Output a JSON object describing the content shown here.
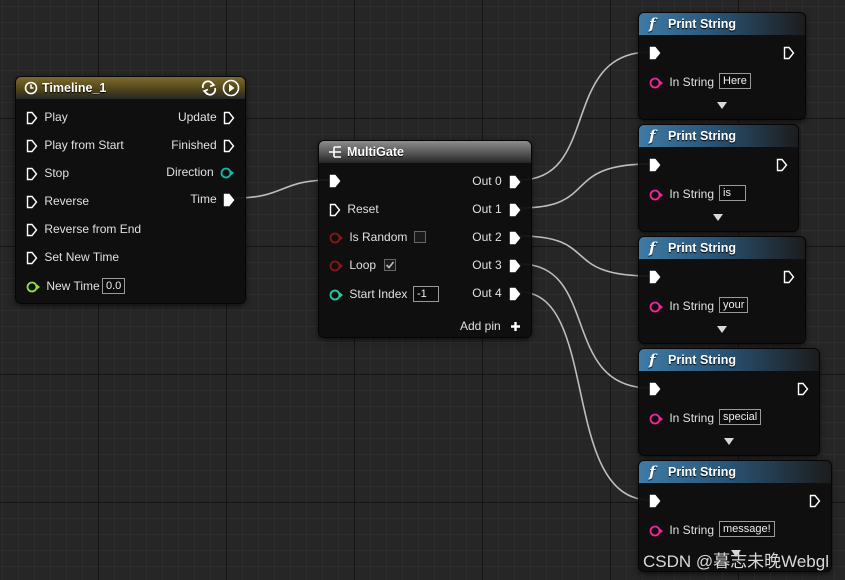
{
  "timeline": {
    "title": "Timeline_1",
    "left_pins": [
      "Play",
      "Play from Start",
      "Stop",
      "Reverse",
      "Reverse from End",
      "Set New Time"
    ],
    "new_time_label": "New Time",
    "new_time_value": "0.0",
    "right_pins": [
      "Update",
      "Finished",
      "Direction",
      "Time"
    ]
  },
  "multigate": {
    "title": "MultiGate",
    "reset_label": "Reset",
    "is_random_label": "Is Random",
    "is_random_checked": false,
    "loop_label": "Loop",
    "loop_checked": true,
    "start_index_label": "Start Index",
    "start_index_value": "-1",
    "outputs": [
      "Out 0",
      "Out 1",
      "Out 2",
      "Out 3",
      "Out 4"
    ],
    "add_pin_label": "Add pin"
  },
  "print_nodes": [
    {
      "title": "Print String",
      "in_label": "In String",
      "value": "Here"
    },
    {
      "title": "Print String",
      "in_label": "In String",
      "value": "is"
    },
    {
      "title": "Print String",
      "in_label": "In String",
      "value": "your"
    },
    {
      "title": "Print String",
      "in_label": "In String",
      "value": "special"
    },
    {
      "title": "Print String",
      "in_label": "In String",
      "value": "message!"
    }
  ],
  "function_icon_glyph": "f",
  "watermark": "CSDN @暮志未晚Webgl",
  "colors": {
    "exec_pin": "#ffffff",
    "string_pin": "#f0269a",
    "bool_pin": "#8a1515",
    "float_pin": "#8ee23a",
    "int_pin": "#20d0a0",
    "direction_pin": "#14b8a8",
    "wire": "#bdbdbd"
  }
}
